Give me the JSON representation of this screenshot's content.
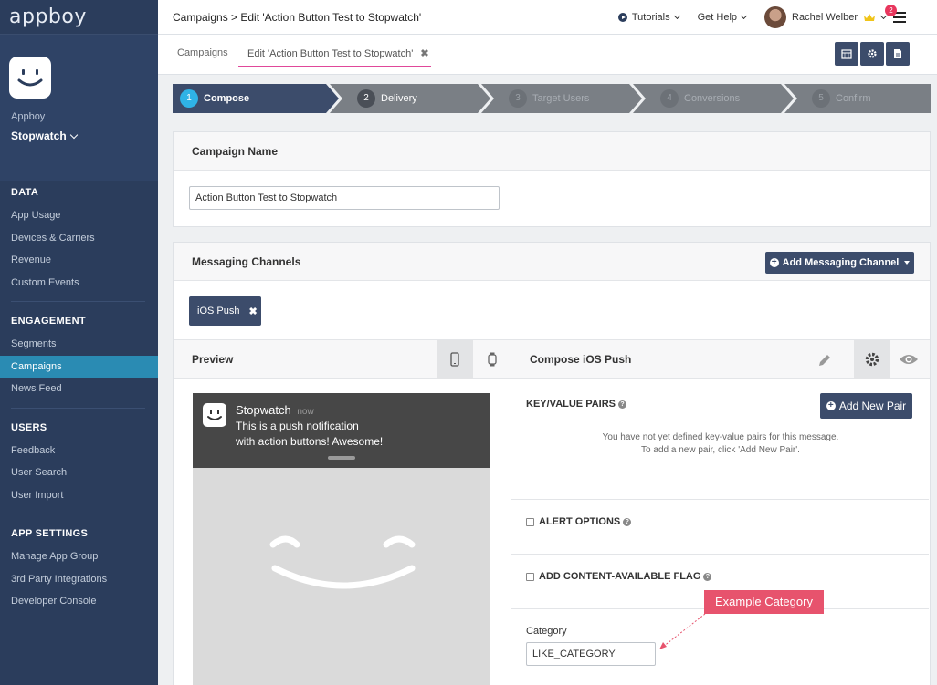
{
  "brand": "appboy",
  "app": {
    "company": "Appboy",
    "name": "Stopwatch"
  },
  "sidebar": {
    "sections": [
      {
        "title": "DATA",
        "items": [
          "App Usage",
          "Devices & Carriers",
          "Revenue",
          "Custom Events"
        ]
      },
      {
        "title": "ENGAGEMENT",
        "items": [
          "Segments",
          "Campaigns",
          "News Feed"
        ]
      },
      {
        "title": "USERS",
        "items": [
          "Feedback",
          "User Search",
          "User Import"
        ]
      },
      {
        "title": "APP SETTINGS",
        "items": [
          "Manage App Group",
          "3rd Party Integrations",
          "Developer Console"
        ]
      }
    ],
    "active_item": "Campaigns"
  },
  "topbar": {
    "breadcrumb": "Campaigns > Edit 'Action Button Test to Stopwatch'",
    "tutorials": "Tutorials",
    "help": "Get Help",
    "user": "Rachel Welber",
    "notification_count": "2"
  },
  "tabs": {
    "campaigns": "Campaigns",
    "edit": "Edit 'Action Button Test to Stopwatch'",
    "close": "✖"
  },
  "steps": [
    {
      "num": "1",
      "label": "Compose"
    },
    {
      "num": "2",
      "label": "Delivery"
    },
    {
      "num": "3",
      "label": "Target Users"
    },
    {
      "num": "4",
      "label": "Conversions"
    },
    {
      "num": "5",
      "label": "Confirm"
    }
  ],
  "campaign_name": {
    "heading": "Campaign Name",
    "value": "Action Button Test to Stopwatch"
  },
  "messaging": {
    "heading": "Messaging Channels",
    "add_button": "Add Messaging Channel",
    "channel": "iOS Push",
    "channel_remove": "✖"
  },
  "preview": {
    "heading": "Preview",
    "app_name": "Stopwatch",
    "time": "now",
    "message_line1": "This is a push notification",
    "message_line2": "with action buttons! Awesome!"
  },
  "compose": {
    "heading": "Compose iOS Push",
    "kv_heading": "KEY/VALUE PAIRS",
    "add_pair": "Add New Pair",
    "kv_empty_line1": "You have not yet defined key-value pairs for this message.",
    "kv_empty_line2": "To add a new pair, click 'Add New Pair'.",
    "alert_options": "ALERT OPTIONS",
    "content_available": "ADD CONTENT-AVAILABLE FLAG",
    "category_label": "Category",
    "category_value": "LIKE_CATEGORY"
  },
  "callout": "Example Category"
}
